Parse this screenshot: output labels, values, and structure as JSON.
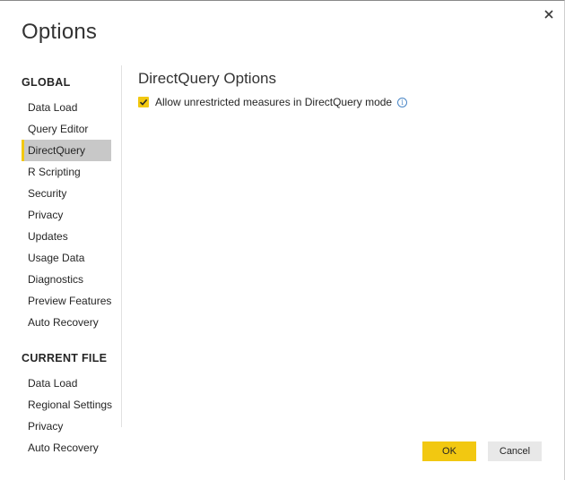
{
  "dialog": {
    "title": "Options",
    "close_icon": "close-icon"
  },
  "nav": {
    "global_title": "GLOBAL",
    "global_items": [
      {
        "label": "Data Load"
      },
      {
        "label": "Query Editor"
      },
      {
        "label": "DirectQuery",
        "selected": true
      },
      {
        "label": "R Scripting"
      },
      {
        "label": "Security"
      },
      {
        "label": "Privacy"
      },
      {
        "label": "Updates"
      },
      {
        "label": "Usage Data"
      },
      {
        "label": "Diagnostics"
      },
      {
        "label": "Preview Features"
      },
      {
        "label": "Auto Recovery"
      }
    ],
    "current_file_title": "CURRENT FILE",
    "current_file_items": [
      {
        "label": "Data Load"
      },
      {
        "label": "Regional Settings"
      },
      {
        "label": "Privacy"
      },
      {
        "label": "Auto Recovery"
      }
    ]
  },
  "content": {
    "title": "DirectQuery Options",
    "option": {
      "label": "Allow unrestricted measures in DirectQuery mode",
      "checked": true,
      "info_icon": "info-icon"
    }
  },
  "buttons": {
    "ok": "OK",
    "cancel": "Cancel"
  },
  "colors": {
    "accent": "#f2c811",
    "selected_background": "#c8c8c8",
    "info": "#4a86c6"
  }
}
